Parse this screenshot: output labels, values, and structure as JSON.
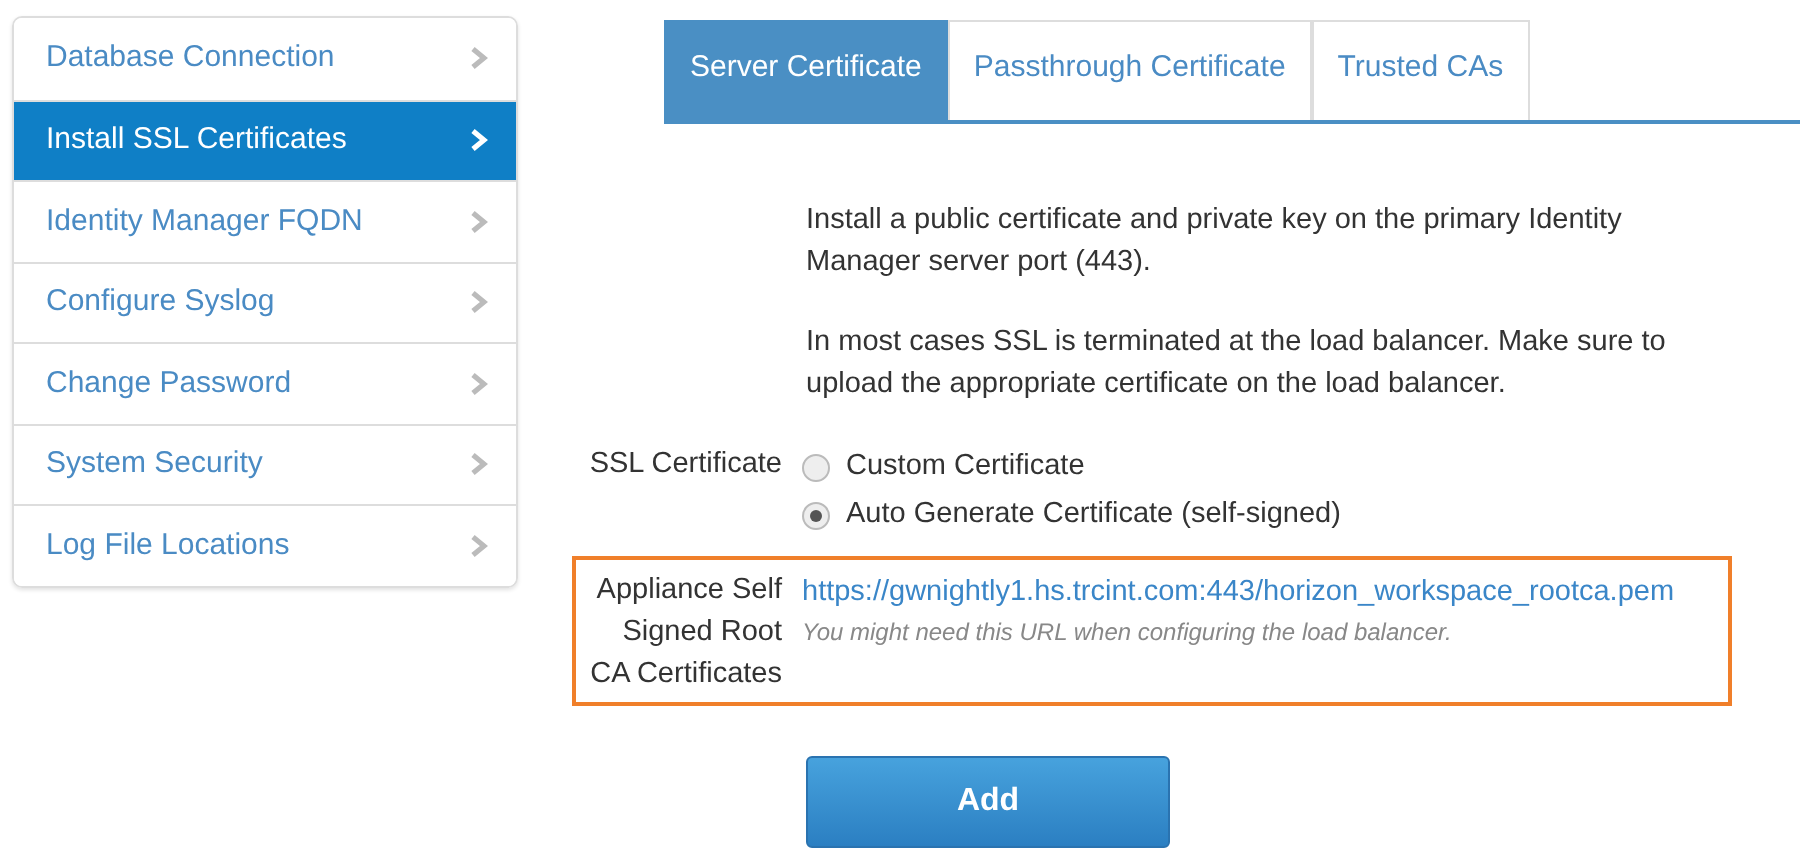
{
  "sidebar": {
    "items": [
      {
        "label": "Database Connection",
        "selected": false
      },
      {
        "label": "Install SSL Certificates",
        "selected": true
      },
      {
        "label": "Identity Manager FQDN",
        "selected": false
      },
      {
        "label": "Configure Syslog",
        "selected": false
      },
      {
        "label": "Change Password",
        "selected": false
      },
      {
        "label": "System Security",
        "selected": false
      },
      {
        "label": "Log File Locations",
        "selected": false
      }
    ]
  },
  "tabs": [
    {
      "label": "Server Certificate",
      "selected": true
    },
    {
      "label": "Passthrough Certificate",
      "selected": false
    },
    {
      "label": "Trusted CAs",
      "selected": false
    }
  ],
  "intro": [
    "Install a public certificate and private key on the primary Identity Manager server port (443).",
    "In most cases SSL is terminated at the load balancer. Make sure to upload the appropriate certificate on the load balancer."
  ],
  "ssl_certificate": {
    "label": "SSL Certificate",
    "options": [
      {
        "label": "Custom Certificate",
        "selected": false
      },
      {
        "label": "Auto Generate Certificate (self-signed)",
        "selected": true
      }
    ]
  },
  "root_ca": {
    "label": "Appliance Self Signed Root CA Certificates",
    "url": "https://gwnightly1.hs.trcint.com:443/horizon_workspace_rootca.pem",
    "hint": "You might need this URL when configuring the load balancer."
  },
  "buttons": [
    "Add"
  ]
}
